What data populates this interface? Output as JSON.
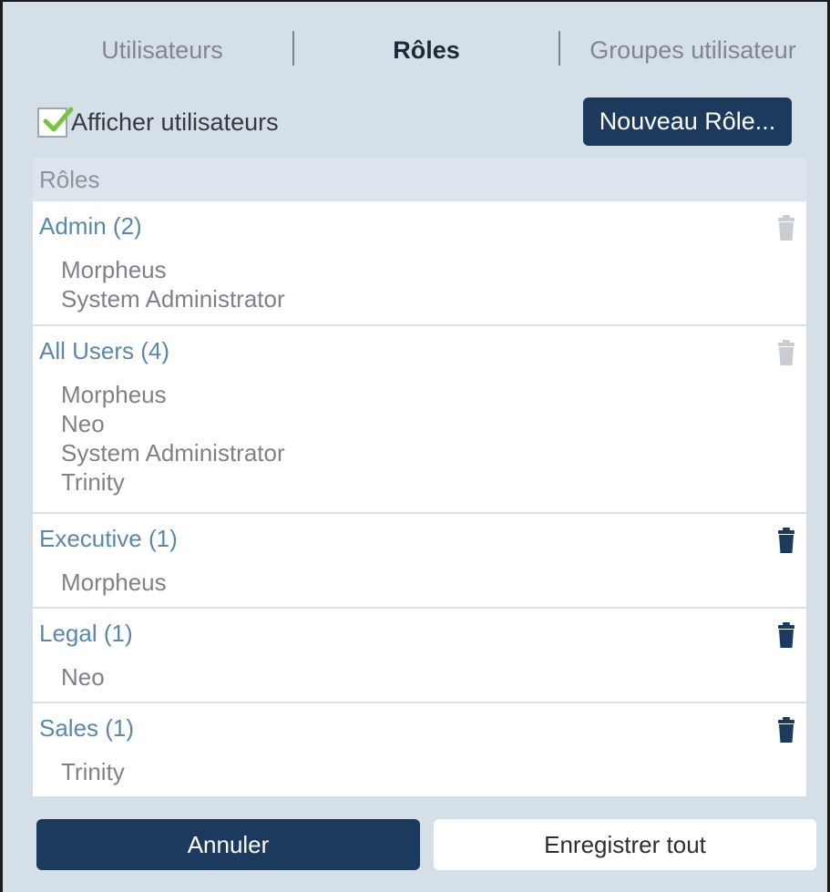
{
  "tabs": [
    {
      "label": "Utilisateurs",
      "active": false
    },
    {
      "label": "Rôles",
      "active": true
    },
    {
      "label": "Groupes utilisateur",
      "active": false
    }
  ],
  "toolbar": {
    "show_users_label": "Afficher utilisateurs",
    "show_users_checked": true,
    "new_role_label": "Nouveau Rôle..."
  },
  "roles_header": "Rôles",
  "roles": [
    {
      "name": "Admin (2)",
      "deletable": false,
      "members": [
        "Morpheus",
        "System Administrator"
      ]
    },
    {
      "name": "All Users (4)",
      "deletable": false,
      "members": [
        "Morpheus",
        "Neo",
        "System Administrator",
        "Trinity"
      ]
    },
    {
      "name": "Executive (1)",
      "deletable": true,
      "members": [
        "Morpheus"
      ]
    },
    {
      "name": "Legal (1)",
      "deletable": true,
      "members": [
        "Neo"
      ]
    },
    {
      "name": "Sales (1)",
      "deletable": true,
      "members": [
        "Trinity"
      ]
    }
  ],
  "footer": {
    "cancel_label": "Annuler",
    "save_all_label": "Enregistrer tout"
  },
  "colors": {
    "panel_bg": "#d5dfe8",
    "primary_button": "#1c3a5e",
    "role_link": "#5b87ad",
    "check_mark": "#7bc142",
    "trash_active": "#1c3a5e",
    "trash_disabled": "#c8cdd2"
  },
  "icons": {
    "checkbox": "check-icon",
    "delete": "trash-icon"
  }
}
